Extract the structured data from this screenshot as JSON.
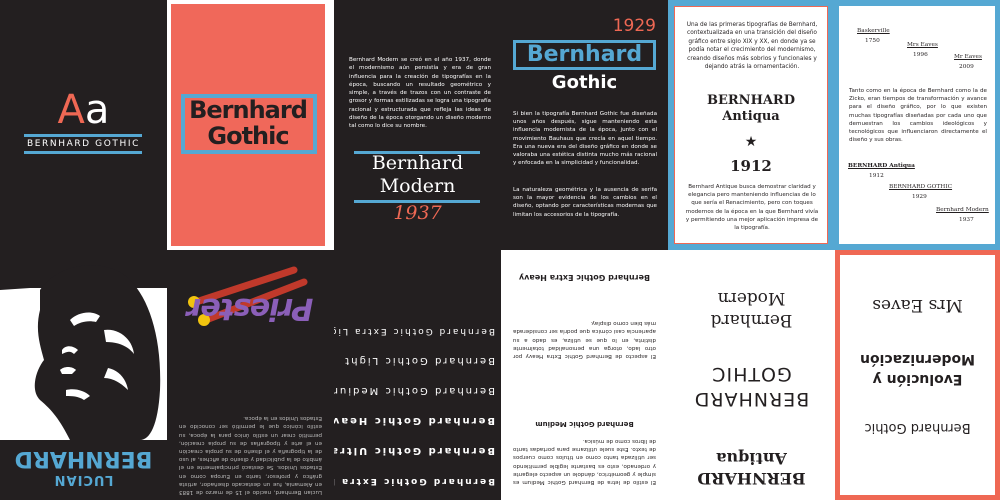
{
  "p1": {
    "letter_upper": "A",
    "letter_lower": "a",
    "label": "BERNHARD GOTHIC"
  },
  "p2": {
    "line1": "Bernhard",
    "line2": "Gothic"
  },
  "p3": {
    "body": "Bernhard Modern se creó en el año 1937, donde el modernismo aún persistía y era de gran influencia para la creación de tipografías en la época, buscando un resultado geométrico y simple, a través de trazos con un contraste de grosor y formas estilizadas se logra una tipografía racional y estructurada que refleja las ideas de diseño de la época otorgando un diseño moderno tal como lo dice su nombre.",
    "title1": "Bernhard",
    "title2": "Modern",
    "year": "1937"
  },
  "p4": {
    "year": "1929",
    "title1": "Bernhard",
    "title2": "Gothic",
    "body1": "Si bien la tipografía Bernhard Gothic fue diseñada unos años después, sigue manteniendo esta influencia modernista de la época, junto con el movimiento Bauhaus que crecía en aquel tiempo. Era una nueva era del diseño gráfico en donde se valoraba una estética distinta mucho más racional y enfocada en la simplicidad y funcionalidad.",
    "body2": "La naturaleza geométrica y la ausencia de serifa son la mayor evidencia de los cambios en el diseño, optando por características modernas que limitan los accesorios de la tipografía."
  },
  "p5": {
    "body1": "Una de las primeras tipografías de Bernhard, contextualizada en una transición del diseño gráfico entre siglo XIX y XX, en donde ya se podía notar el crecimiento del modernismo, creando diseños más sobrios y funcionales y dejando atrás la ornamentación.",
    "title1": "BERNHARD",
    "title2": "Antiqua",
    "star": "★",
    "year": "1912",
    "body2": "Bernhard Antique busca demostrar claridad y elegancia pero manteniendo influencias de lo que sería el Renacimiento, pero con toques modernos de la época en la que Bernhard vivía y permitiendo una mejor aplicación impresa de la tipografía."
  },
  "p6": {
    "baskerville": "Baskerville",
    "y1750": "1750",
    "mrseaves1": "Mrs Eaves",
    "y1996": "1996",
    "mreaves": "Mr Eaves",
    "y2009": "2009",
    "body": "Tanto como en la época de Bernhard como la de Zicko, eran tiempos de transformación y avance para el diseño gráfico, por lo que existen muchas tipografías diseñadas por cada uno que demuestran los cambios ideológicos y tecnológicos que influenciaron directamente el diseño y sus obras.",
    "antiqua": "BERNHARD Antiqua",
    "y1912": "1912",
    "gothic": "BERNHARD GOTHIC",
    "y1929": "1929",
    "modern": "Bernhard Modern",
    "y1937": "1937"
  },
  "p7": {
    "word1": "BERNHARD",
    "word2": "LUCIAN"
  },
  "p8": {
    "body": "Lucian Bernhard, nacido el 15 de marzo de 1883 en Alemania, fue un destacado diseñador, artista gráfico y profesor, tanto en Europa como en Estados Unidos. Se destacó principalmente en el ámbito de la publicidad y diseño de afiches, al uso de la tipografía y el diseño de su propia creación en el arte y tipografías de su propia creación, permitió crear un estilo único para la época, su estilo icónico que le permitió ser conocido en Estados Unidos en la época.",
    "logo": "Priester"
  },
  "p9": {
    "w1": "Bernhard Gothic Extra Heavy",
    "w2": "Bernhard Gothic Ultra",
    "w3": "Bernhard Gothic Heavy",
    "w4": "Bernhard Gothic Medium",
    "w5": "Bernhard Gothic Light",
    "w6": "Bernhard Gothic Extra Light"
  },
  "p10": {
    "head1": "Bernhard Gothic Extra Heavy",
    "body1": "El aspecto de Bernhard Gothic Extra Heavy por otro lado, otorga una personalidad totalmente distinta, en lo que se utiliza, es dado a su apariencia casi cómica que podría ser considerada más bien como display.",
    "head2": "Bernhard Gothic Medium",
    "body2": "El estilo de letra de Bernhard Gothic Medium es simple y geométrico, dándole un aspecto elegante y ordenado, esto es bastante legible permitiendo ser utilizada tanto como en títulos como cuerpos de texto. Este suele utilizarse para portadas tanto de libros como de música."
  },
  "p11": {
    "modern1": "Bernhard",
    "modern2": "Modern",
    "gothic1": "BERNHARD",
    "gothic2": "GOTHIC",
    "antiqua1": "BERNHARD",
    "antiqua2": "Antiqua"
  },
  "p12": {
    "mrseaves": "Mrs Eaves",
    "evo1": "Evolución y",
    "evo2": "Modernización",
    "bg": "Bernhard Gothic"
  }
}
